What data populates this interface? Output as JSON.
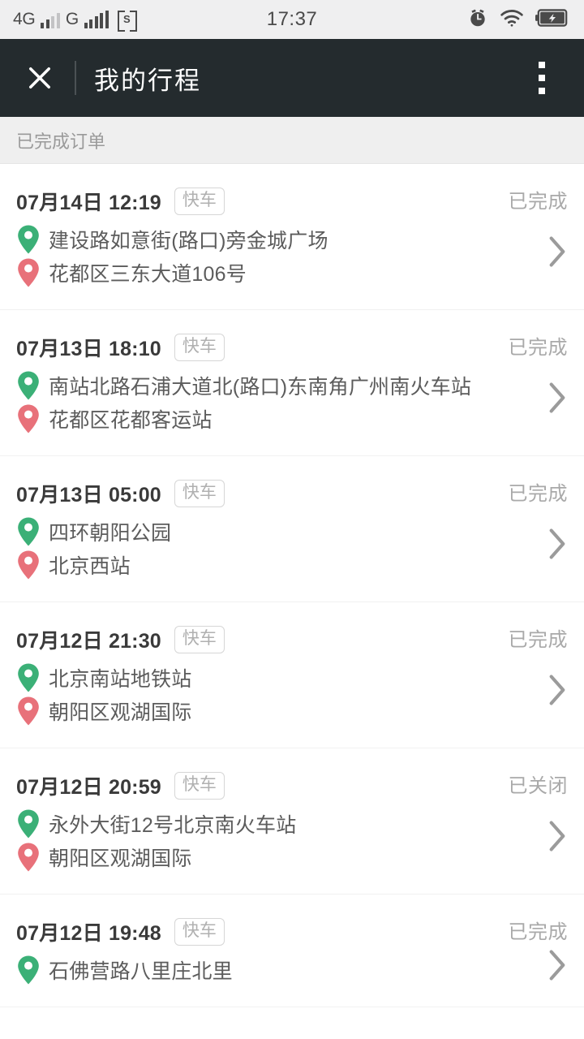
{
  "statusbar": {
    "network_1": "4G",
    "network_2": "G",
    "sim_badge": "S",
    "time": "17:37",
    "icons": [
      "alarm-clock-icon",
      "wifi-icon",
      "battery-charging-icon"
    ]
  },
  "titlebar": {
    "close_icon": "close-icon",
    "title": "我的行程",
    "menu_icon": "overflow-menu-icon"
  },
  "section": {
    "label": "已完成订单"
  },
  "colors": {
    "header_bg": "#242b2e",
    "statusbar_bg": "#efeff0",
    "band_bg": "#efefef",
    "pin_origin": "#3bb077",
    "pin_destination": "#e8717a",
    "status_text": "#a9a9a9",
    "address_text": "#5c5c5c",
    "date_text": "#3a3a3a"
  },
  "trips": [
    {
      "date": "07月14日 12:19",
      "tag": "快车",
      "status": "已完成",
      "origin": "建设路如意街(路口)旁金城广场",
      "destination": "花都区三东大道106号"
    },
    {
      "date": "07月13日 18:10",
      "tag": "快车",
      "status": "已完成",
      "origin": "南站北路石浦大道北(路口)东南角广州南火车站",
      "destination": "花都区花都客运站"
    },
    {
      "date": "07月13日 05:00",
      "tag": "快车",
      "status": "已完成",
      "origin": "四环朝阳公园",
      "destination": "北京西站"
    },
    {
      "date": "07月12日 21:30",
      "tag": "快车",
      "status": "已完成",
      "origin": "北京南站地铁站",
      "destination": "朝阳区观湖国际"
    },
    {
      "date": "07月12日 20:59",
      "tag": "快车",
      "status": "已关闭",
      "origin": "永外大街12号北京南火车站",
      "destination": "朝阳区观湖国际"
    },
    {
      "date": "07月12日 19:48",
      "tag": "快车",
      "status": "已完成",
      "origin": "石佛营路八里庄北里",
      "destination": ""
    }
  ]
}
